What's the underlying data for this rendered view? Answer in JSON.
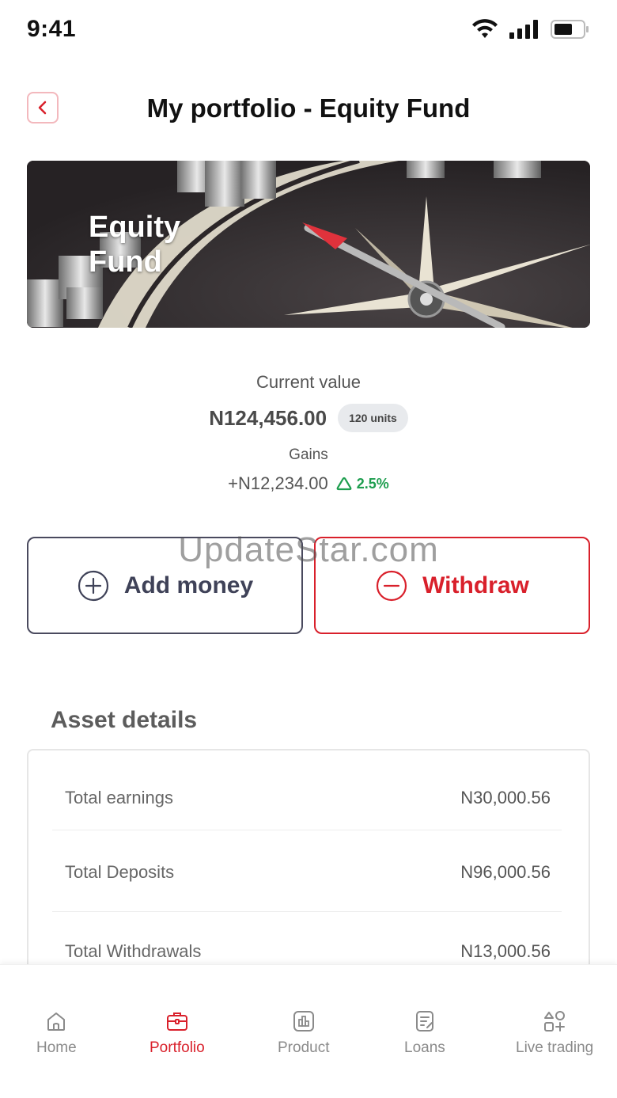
{
  "status": {
    "time": "9:41"
  },
  "header": {
    "title": "My portfolio - Equity Fund"
  },
  "hero": {
    "title": "Equity Fund"
  },
  "portfolio": {
    "current_value_label": "Current value",
    "current_value": "N124,456.00",
    "units": "120 units",
    "gains_label": "Gains",
    "gains_amount": "+N12,234.00",
    "gains_percent": "2.5%"
  },
  "actions": {
    "add_label": "Add money",
    "withdraw_label": "Withdraw"
  },
  "watermark": "UpdateStar.com",
  "assets": {
    "title": "Asset details",
    "rows": [
      {
        "label": "Total earnings",
        "value": "N30,000.56"
      },
      {
        "label": "Total Deposits",
        "value": "N96,000.56"
      },
      {
        "label": "Total Withdrawals",
        "value": "N13,000.56"
      }
    ]
  },
  "nav": {
    "items": [
      {
        "label": "Home",
        "icon": "home-icon"
      },
      {
        "label": "Portfolio",
        "icon": "briefcase-icon"
      },
      {
        "label": "Product",
        "icon": "chart-icon"
      },
      {
        "label": "Loans",
        "icon": "document-icon"
      },
      {
        "label": "Live trading",
        "icon": "grid-icon"
      }
    ],
    "active": "Portfolio"
  },
  "colors": {
    "accent": "#d9202b",
    "positive": "#1e9e4f",
    "dark_button": "#3f4258"
  }
}
